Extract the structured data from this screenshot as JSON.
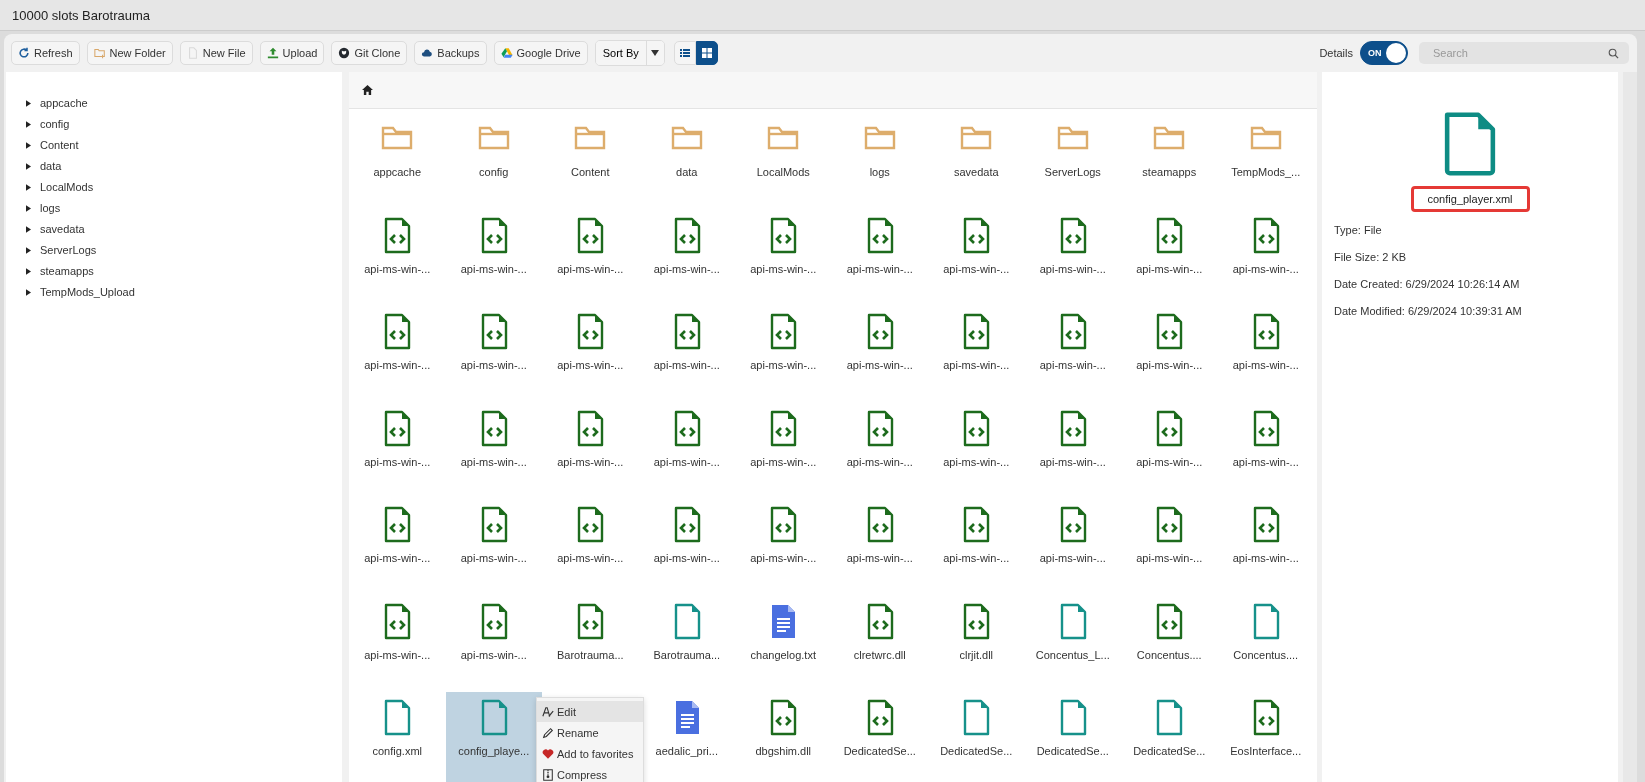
{
  "window": {
    "title": "10000 slots Barotrauma"
  },
  "toolbar": {
    "buttons": [
      {
        "label": "Refresh",
        "kind": "refresh"
      },
      {
        "label": "New Folder",
        "kind": "new-folder"
      },
      {
        "label": "New File",
        "kind": "new-file"
      },
      {
        "label": "Upload",
        "kind": "upload"
      },
      {
        "label": "Git Clone",
        "kind": "git"
      },
      {
        "label": "Backups",
        "kind": "cloud"
      },
      {
        "label": "Google Drive",
        "kind": "drive"
      }
    ],
    "sort": {
      "label": "Sort By"
    },
    "views": [
      {
        "kind": "list",
        "selected": false
      },
      {
        "kind": "grid",
        "selected": true
      }
    ],
    "details_toggle": {
      "label": "Details",
      "text": "ON",
      "on": true
    },
    "search": {
      "placeholder": "Search"
    }
  },
  "tree": [
    {
      "name": "appcache",
      "expanded": false
    },
    {
      "name": "config",
      "expanded": false
    },
    {
      "name": "Content",
      "expanded": false
    },
    {
      "name": "data",
      "expanded": false
    },
    {
      "name": "LocalMods",
      "expanded": false
    },
    {
      "name": "logs",
      "expanded": false
    },
    {
      "name": "savedata",
      "expanded": false
    },
    {
      "name": "ServerLogs",
      "expanded": false
    },
    {
      "name": "steamapps",
      "expanded": false
    },
    {
      "name": "TempMods_Upload",
      "expanded": false
    }
  ],
  "grid": {
    "rows": [
      [
        {
          "name": "appcache",
          "kind": "folder",
          "selected": false
        },
        {
          "name": "config",
          "kind": "folder",
          "selected": false
        },
        {
          "name": "Content",
          "kind": "folder",
          "selected": false
        },
        {
          "name": "data",
          "kind": "folder",
          "selected": false
        },
        {
          "name": "LocalMods",
          "kind": "folder",
          "selected": false
        },
        {
          "name": "logs",
          "kind": "folder",
          "selected": false
        },
        {
          "name": "savedata",
          "kind": "folder",
          "selected": false
        },
        {
          "name": "ServerLogs",
          "kind": "folder",
          "selected": false
        },
        {
          "name": "steamapps",
          "kind": "folder",
          "selected": false
        },
        {
          "name": "TempMods_...",
          "kind": "folder",
          "selected": false
        }
      ],
      [
        {
          "name": "api-ms-win-...",
          "kind": "code",
          "selected": false
        },
        {
          "name": "api-ms-win-...",
          "kind": "code",
          "selected": false
        },
        {
          "name": "api-ms-win-...",
          "kind": "code",
          "selected": false
        },
        {
          "name": "api-ms-win-...",
          "kind": "code",
          "selected": false
        },
        {
          "name": "api-ms-win-...",
          "kind": "code",
          "selected": false
        },
        {
          "name": "api-ms-win-...",
          "kind": "code",
          "selected": false
        },
        {
          "name": "api-ms-win-...",
          "kind": "code",
          "selected": false
        },
        {
          "name": "api-ms-win-...",
          "kind": "code",
          "selected": false
        },
        {
          "name": "api-ms-win-...",
          "kind": "code",
          "selected": false
        },
        {
          "name": "api-ms-win-...",
          "kind": "code",
          "selected": false
        }
      ],
      [
        {
          "name": "api-ms-win-...",
          "kind": "code",
          "selected": false
        },
        {
          "name": "api-ms-win-...",
          "kind": "code",
          "selected": false
        },
        {
          "name": "api-ms-win-...",
          "kind": "code",
          "selected": false
        },
        {
          "name": "api-ms-win-...",
          "kind": "code",
          "selected": false
        },
        {
          "name": "api-ms-win-...",
          "kind": "code",
          "selected": false
        },
        {
          "name": "api-ms-win-...",
          "kind": "code",
          "selected": false
        },
        {
          "name": "api-ms-win-...",
          "kind": "code",
          "selected": false
        },
        {
          "name": "api-ms-win-...",
          "kind": "code",
          "selected": false
        },
        {
          "name": "api-ms-win-...",
          "kind": "code",
          "selected": false
        },
        {
          "name": "api-ms-win-...",
          "kind": "code",
          "selected": false
        }
      ],
      [
        {
          "name": "api-ms-win-...",
          "kind": "code",
          "selected": false
        },
        {
          "name": "api-ms-win-...",
          "kind": "code",
          "selected": false
        },
        {
          "name": "api-ms-win-...",
          "kind": "code",
          "selected": false
        },
        {
          "name": "api-ms-win-...",
          "kind": "code",
          "selected": false
        },
        {
          "name": "api-ms-win-...",
          "kind": "code",
          "selected": false
        },
        {
          "name": "api-ms-win-...",
          "kind": "code",
          "selected": false
        },
        {
          "name": "api-ms-win-...",
          "kind": "code",
          "selected": false
        },
        {
          "name": "api-ms-win-...",
          "kind": "code",
          "selected": false
        },
        {
          "name": "api-ms-win-...",
          "kind": "code",
          "selected": false
        },
        {
          "name": "api-ms-win-...",
          "kind": "code",
          "selected": false
        }
      ],
      [
        {
          "name": "api-ms-win-...",
          "kind": "code",
          "selected": false
        },
        {
          "name": "api-ms-win-...",
          "kind": "code",
          "selected": false
        },
        {
          "name": "api-ms-win-...",
          "kind": "code",
          "selected": false
        },
        {
          "name": "api-ms-win-...",
          "kind": "code",
          "selected": false
        },
        {
          "name": "api-ms-win-...",
          "kind": "code",
          "selected": false
        },
        {
          "name": "api-ms-win-...",
          "kind": "code",
          "selected": false
        },
        {
          "name": "api-ms-win-...",
          "kind": "code",
          "selected": false
        },
        {
          "name": "api-ms-win-...",
          "kind": "code",
          "selected": false
        },
        {
          "name": "api-ms-win-...",
          "kind": "code",
          "selected": false
        },
        {
          "name": "api-ms-win-...",
          "kind": "code",
          "selected": false
        }
      ],
      [
        {
          "name": "api-ms-win-...",
          "kind": "code",
          "selected": false
        },
        {
          "name": "api-ms-win-...",
          "kind": "code",
          "selected": false
        },
        {
          "name": "Barotrauma...",
          "kind": "code",
          "selected": false
        },
        {
          "name": "Barotrauma...",
          "kind": "file",
          "selected": false
        },
        {
          "name": "changelog.txt",
          "kind": "doc",
          "selected": false
        },
        {
          "name": "clretwrc.dll",
          "kind": "code",
          "selected": false
        },
        {
          "name": "clrjit.dll",
          "kind": "code",
          "selected": false
        },
        {
          "name": "Concentus_L...",
          "kind": "file",
          "selected": false
        },
        {
          "name": "Concentus....",
          "kind": "code",
          "selected": false
        },
        {
          "name": "Concentus....",
          "kind": "file",
          "selected": false
        }
      ],
      [
        {
          "name": "config.xml",
          "kind": "file",
          "selected": false
        },
        {
          "name": "config_playe...",
          "kind": "file",
          "selected": true
        },
        null,
        {
          "name": "aedalic_pri...",
          "kind": "doc",
          "selected": false
        },
        {
          "name": "dbgshim.dll",
          "kind": "code",
          "selected": false
        },
        {
          "name": "DedicatedSe...",
          "kind": "code",
          "selected": false
        },
        {
          "name": "DedicatedSe...",
          "kind": "file",
          "selected": false
        },
        {
          "name": "DedicatedSe...",
          "kind": "file",
          "selected": false
        },
        {
          "name": "DedicatedSe...",
          "kind": "file",
          "selected": false
        },
        {
          "name": "EosInterface...",
          "kind": "code",
          "selected": false
        }
      ]
    ]
  },
  "context_menu": [
    {
      "label": "Edit",
      "kind": "edit",
      "selected": true
    },
    {
      "label": "Rename",
      "kind": "rename",
      "selected": false
    },
    {
      "label": "Add to favorites",
      "kind": "favorite",
      "selected": false
    },
    {
      "label": "Compress",
      "kind": "compress",
      "selected": false
    }
  ],
  "details": {
    "name": "config_player.xml",
    "lines": [
      "Type: File",
      "File Size: 2 KB",
      "Date Created: 6/29/2024 10:26:14 AM",
      "Date Modified: 6/29/2024 10:39:31 AM"
    ]
  }
}
